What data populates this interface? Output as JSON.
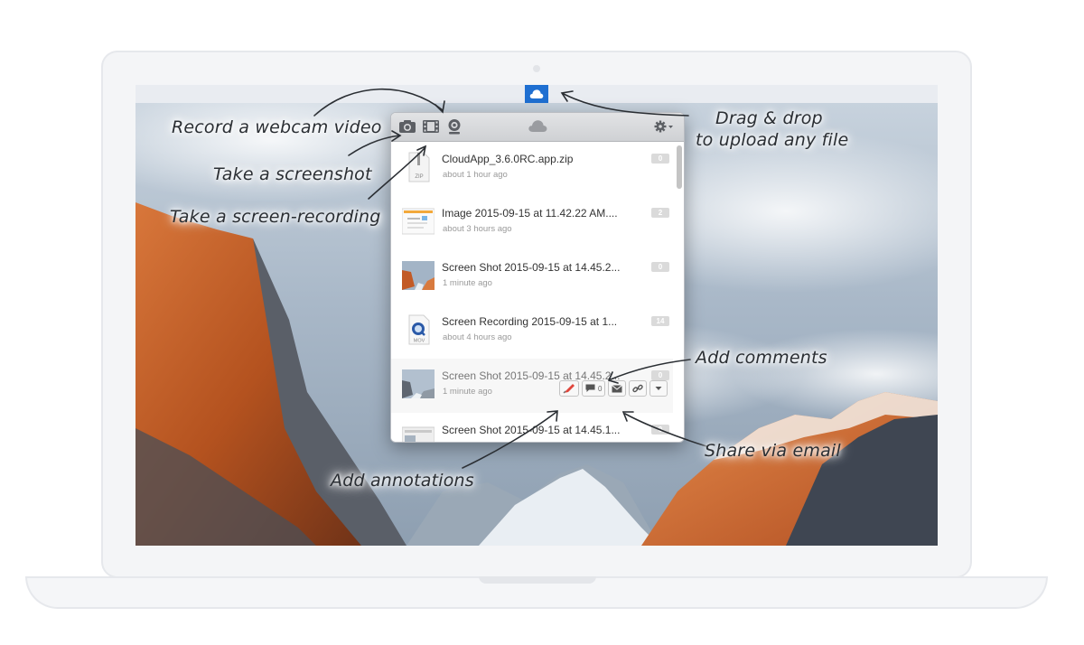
{
  "menubar": {
    "app_icon": "cloud-icon"
  },
  "popover": {
    "toolbar": {
      "camera_icon": "camera-icon",
      "video_icon": "film-icon",
      "webcam_icon": "webcam-icon",
      "logo_icon": "cloud-icon",
      "settings_icon": "gear-icon"
    },
    "files": [
      {
        "name": "CloudApp_3.6.0RC.app.zip",
        "time": "about 1 hour ago",
        "views": "0",
        "thumb_label": "ZIP"
      },
      {
        "name": "Image 2015-09-15 at 11.42.22 AM....",
        "time": "about 3 hours ago",
        "views": "2"
      },
      {
        "name": "Screen Shot 2015-09-15 at 14.45.2...",
        "time": "1 minute ago",
        "views": "0"
      },
      {
        "name": "Screen Recording 2015-09-15 at 1...",
        "time": "about 4 hours ago",
        "views": "14",
        "thumb_label": "MOV"
      },
      {
        "name": "Screen Shot 2015-09-15 at 14.45.2...",
        "time": "1 minute ago",
        "views": "0",
        "actions": {
          "comment_count": "0"
        }
      },
      {
        "name": "Screen Shot 2015-09-15 at 14.45.1...",
        "time": "",
        "views": "0"
      }
    ]
  },
  "callouts": {
    "webcam": "Record a webcam video",
    "screenshot": "Take a screenshot",
    "recording": "Take a screen-recording",
    "drag_line1": "Drag & drop",
    "drag_line2": "to upload any file",
    "comments": "Add comments",
    "email": "Share via email",
    "annotations": "Add annotations"
  },
  "colors": {
    "accent": "#1f6fd1",
    "toolbar_icon": "#5c5f64"
  }
}
